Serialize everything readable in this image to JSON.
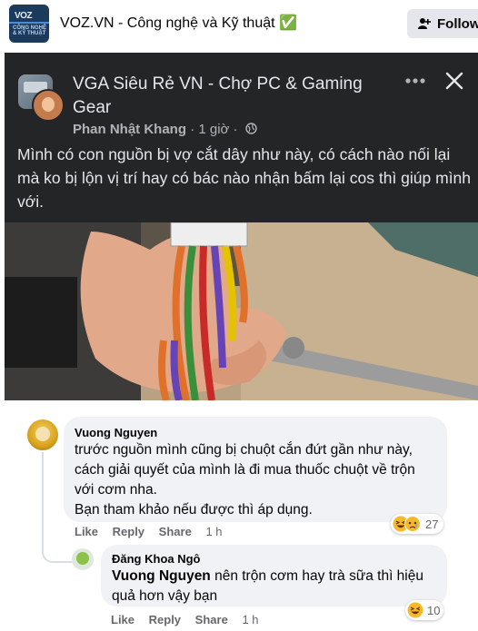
{
  "header": {
    "page_name": "VOZ.VN - Công nghệ và Kỹ thuật ✅",
    "logo_text_top": "VOZ",
    "logo_text_bottom": "CÔNG NGHỆ & KỸ THUẬT",
    "follow_label": "Follow"
  },
  "post": {
    "group_name": "VGA Siêu Rẻ VN - Chợ PC & Gaming Gear",
    "author": "Phan Nhật Khang",
    "time": "· 1 giờ ·",
    "text": "Mình có con nguồn bị vợ cắt dây như này, có cách nào nối lại mà ko bị lộn vị trí hay có bác nào nhận bấm lại cos thì giúp mình với."
  },
  "comments": [
    {
      "name": "Vuong Nguyen",
      "lines": [
        "trước nguồn mình cũng bị chuột cắn đứt gần như này,",
        "cách giải quyết của mình là đi mua thuốc chuột về trộn",
        "với cơm nha.",
        "Bạn tham khảo nếu được thì áp dụng."
      ],
      "like": "Like",
      "reply": "Reply",
      "share": "Share",
      "time": "1 h",
      "reaction_count": "27"
    },
    {
      "name": "Đăng Khoa Ngô",
      "mention": "Vuong Nguyen",
      "line1_rest": " nên trộn cơm hay trà sữa thì hiệu",
      "line2": "quả hơn vậy bạn",
      "like": "Like",
      "reply": "Reply",
      "share": "Share",
      "time": "1 h",
      "reaction_count": "10"
    }
  ],
  "colors": {
    "dark_bg": "#242526",
    "bubble_bg": "#f0f2f5",
    "haha_emoji": "#f7b928"
  }
}
